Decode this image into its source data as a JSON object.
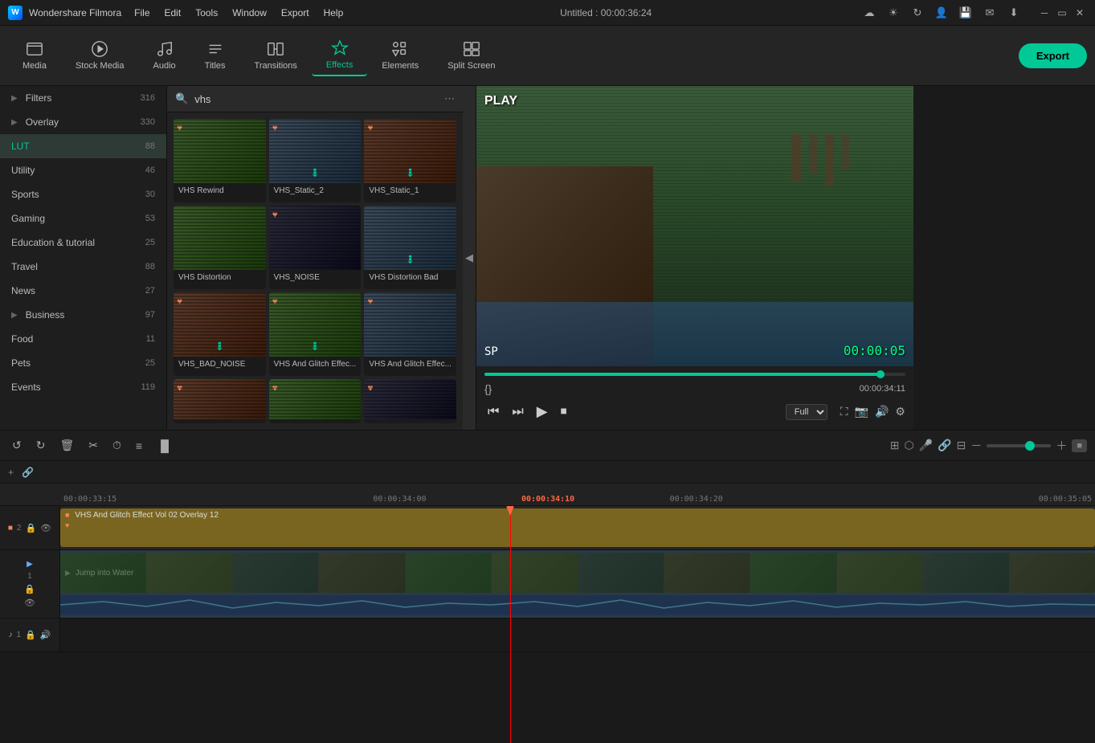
{
  "app": {
    "name": "Wondershare Filmora",
    "title": "Untitled : 00:00:36:24"
  },
  "menu": [
    "File",
    "Edit",
    "Tools",
    "Window",
    "Export",
    "Help"
  ],
  "toolbar": {
    "items": [
      {
        "id": "media",
        "label": "Media",
        "icon": "folder"
      },
      {
        "id": "stock-media",
        "label": "Stock Media",
        "icon": "play-circle"
      },
      {
        "id": "audio",
        "label": "Audio",
        "icon": "music"
      },
      {
        "id": "titles",
        "label": "Titles",
        "icon": "type"
      },
      {
        "id": "transitions",
        "label": "Transitions",
        "icon": "swap"
      },
      {
        "id": "effects",
        "label": "Effects",
        "icon": "star"
      },
      {
        "id": "elements",
        "label": "Elements",
        "icon": "shapes"
      },
      {
        "id": "split-screen",
        "label": "Split Screen",
        "icon": "grid"
      }
    ],
    "active": "effects",
    "export_label": "Export"
  },
  "sidebar": {
    "items": [
      {
        "id": "filters",
        "label": "Filters",
        "count": 316,
        "expandable": true
      },
      {
        "id": "overlay",
        "label": "Overlay",
        "count": 330,
        "expandable": true
      },
      {
        "id": "lut",
        "label": "LUT",
        "count": 88,
        "expandable": false,
        "active": true
      },
      {
        "id": "utility",
        "label": "Utility",
        "count": 46,
        "expandable": false
      },
      {
        "id": "sports",
        "label": "Sports",
        "count": 30,
        "expandable": false
      },
      {
        "id": "gaming",
        "label": "Gaming",
        "count": 53,
        "expandable": false
      },
      {
        "id": "education",
        "label": "Education & tutorial",
        "count": 25,
        "expandable": false
      },
      {
        "id": "travel",
        "label": "Travel",
        "count": 88,
        "expandable": false
      },
      {
        "id": "news",
        "label": "News",
        "count": 27,
        "expandable": false
      },
      {
        "id": "business",
        "label": "Business",
        "count": 97,
        "expandable": true
      },
      {
        "id": "food",
        "label": "Food",
        "count": 11,
        "expandable": false
      },
      {
        "id": "pets",
        "label": "Pets",
        "count": 25,
        "expandable": false
      },
      {
        "id": "events",
        "label": "Events",
        "count": 119,
        "expandable": false
      }
    ]
  },
  "search": {
    "value": "vhs",
    "placeholder": "Search"
  },
  "effects": {
    "items": [
      {
        "id": "vhs-rewind",
        "label": "VHS Rewind",
        "has_heart": true,
        "has_download": false,
        "color": "vhs1"
      },
      {
        "id": "vhs-static-2",
        "label": "VHS_Static_2",
        "has_heart": true,
        "has_download": true,
        "color": "vhs2"
      },
      {
        "id": "vhs-static-1",
        "label": "VHS_Static_1",
        "has_heart": true,
        "has_download": true,
        "color": "vhs3"
      },
      {
        "id": "vhs-distortion",
        "label": "VHS Distortion",
        "has_heart": false,
        "has_download": false,
        "color": "vhs1"
      },
      {
        "id": "vhs-noise",
        "label": "VHS_NOISE",
        "has_heart": true,
        "has_download": false,
        "color": "vhs-noise"
      },
      {
        "id": "vhs-distortion-bad",
        "label": "VHS Distortion Bad",
        "has_heart": false,
        "has_download": true,
        "color": "vhs2"
      },
      {
        "id": "vhs-bad-noise",
        "label": "VHS_BAD_NOISE",
        "has_heart": true,
        "has_download": true,
        "color": "vhs3"
      },
      {
        "id": "vhs-glitch-1",
        "label": "VHS And Glitch Effec...",
        "has_heart": true,
        "has_download": true,
        "color": "vhs1"
      },
      {
        "id": "vhs-glitch-2",
        "label": "VHS And Glitch Effec...",
        "has_heart": true,
        "has_download": false,
        "color": "vhs2"
      },
      {
        "id": "vhs-row4-1",
        "label": "",
        "has_heart": true,
        "has_download": false,
        "color": "vhs3"
      },
      {
        "id": "vhs-row4-2",
        "label": "",
        "has_heart": true,
        "has_download": false,
        "color": "vhs1"
      },
      {
        "id": "vhs-row4-3",
        "label": "",
        "has_heart": true,
        "has_download": false,
        "color": "vhs-noise"
      }
    ]
  },
  "preview": {
    "overlay_text": "PLAY",
    "sp_label": "SP",
    "timecode": "00:00:05",
    "time_position": "00:00:34:11",
    "duration": "00:00:34:11",
    "progress_pct": 95,
    "quality": "Full",
    "bracket_left": "{",
    "bracket_right": "}"
  },
  "timeline": {
    "tracks": [
      {
        "id": "track2",
        "label": "2",
        "clip_label": "VHS And Glitch Effect Vol 02 Overlay 12",
        "clip_type": "overlay"
      },
      {
        "id": "track1",
        "label": "1",
        "clip_label": "Jump into Water",
        "clip_type": "video"
      },
      {
        "id": "audio1",
        "label": "1",
        "clip_type": "audio"
      }
    ],
    "ruler_marks": [
      "00:00:33:15",
      "00:00:34:00",
      "00:00:34:10",
      "00:00:34:20",
      "00:00:35:05"
    ],
    "playhead_time": "00:00:34:10"
  }
}
